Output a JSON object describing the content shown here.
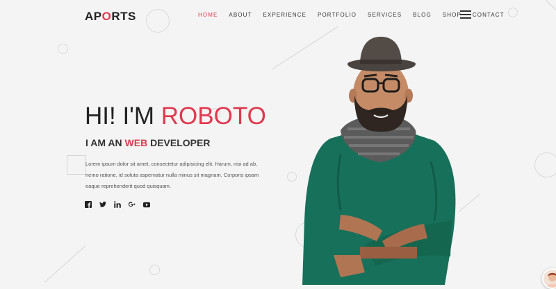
{
  "brand": {
    "logo_prefix": "AP",
    "logo_accent": "O",
    "logo_suffix": "RTS"
  },
  "nav": {
    "items": [
      {
        "label": "HOME",
        "active": true
      },
      {
        "label": "ABOUT"
      },
      {
        "label": "EXPERIENCE"
      },
      {
        "label": "PORTFOLIO"
      },
      {
        "label": "SERVICES"
      },
      {
        "label": "BLOG"
      },
      {
        "label": "SHOP"
      },
      {
        "label": "CONTACT"
      }
    ],
    "menu_icon": "hamburger-menu-icon"
  },
  "hero": {
    "greeting": "HI! I'M",
    "name": "ROBOTO",
    "subtitle_prefix": "I AM AN",
    "subtitle_accent": "WEB",
    "subtitle_suffix": "DEVELOPER",
    "description": "Lorem ipsum dolor sit amet, consectetur adipisicing elit. Harum, nisi ad ab, nemo ratione, id soluta aspernatur nulla minus sit magnam. Corporis ipsam eaque reprehenderit quod quisquam."
  },
  "social": [
    "facebook-icon",
    "twitter-icon",
    "linkedin-icon",
    "google-plus-icon",
    "youtube-icon"
  ],
  "colors": {
    "accent": "#e0394f",
    "background": "#f4f4f4",
    "text": "#222222"
  }
}
